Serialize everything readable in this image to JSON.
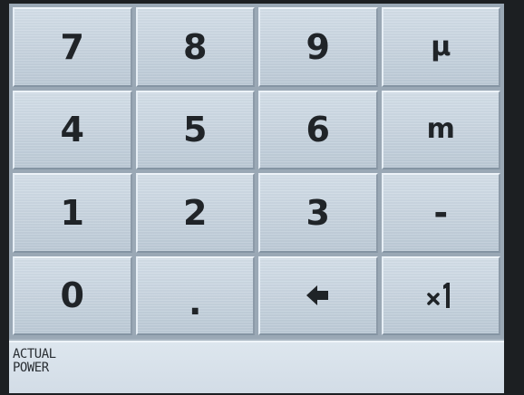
{
  "keypad": {
    "keys": [
      {
        "label": "7"
      },
      {
        "label": "8"
      },
      {
        "label": "9"
      },
      {
        "label": "μ"
      },
      {
        "label": "4"
      },
      {
        "label": "5"
      },
      {
        "label": "6"
      },
      {
        "label": "m"
      },
      {
        "label": "1"
      },
      {
        "label": "2"
      },
      {
        "label": "3"
      },
      {
        "label": "-"
      },
      {
        "label": "0"
      },
      {
        "label": "."
      },
      {
        "icon": "backspace-arrow-icon"
      },
      {
        "icon": "times-one-icon"
      }
    ]
  },
  "status_bar": {
    "label": "ACTUAL\nPOWER"
  }
}
